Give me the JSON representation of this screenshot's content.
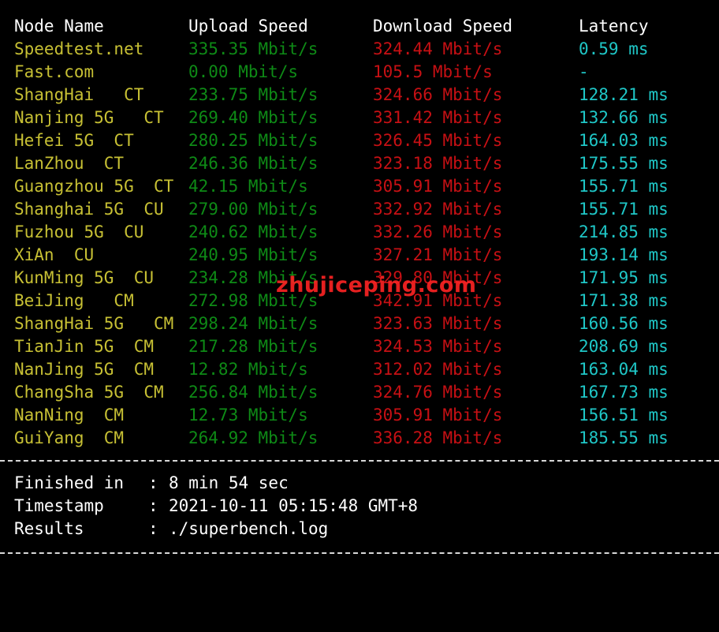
{
  "headers": {
    "node": "Node Name",
    "upload": "Upload Speed",
    "download": "Download Speed",
    "latency": "Latency"
  },
  "rows": [
    {
      "node": "Speedtest.net",
      "upload": "335.35 Mbit/s",
      "download": "324.44 Mbit/s",
      "latency": "0.59 ms"
    },
    {
      "node": "Fast.com",
      "upload": "0.00 Mbit/s",
      "download": "105.5 Mbit/s",
      "latency": "-"
    },
    {
      "node": "ShangHai   CT",
      "upload": "233.75 Mbit/s",
      "download": "324.66 Mbit/s",
      "latency": "128.21 ms"
    },
    {
      "node": "Nanjing 5G   CT",
      "upload": "269.40 Mbit/s",
      "download": "331.42 Mbit/s",
      "latency": "132.66 ms"
    },
    {
      "node": "Hefei 5G  CT",
      "upload": "280.25 Mbit/s",
      "download": "326.45 Mbit/s",
      "latency": "164.03 ms"
    },
    {
      "node": "LanZhou  CT",
      "upload": "246.36 Mbit/s",
      "download": "323.18 Mbit/s",
      "latency": "175.55 ms"
    },
    {
      "node": "Guangzhou 5G  CT",
      "upload": "42.15 Mbit/s",
      "download": "305.91 Mbit/s",
      "latency": "155.71 ms"
    },
    {
      "node": "Shanghai 5G  CU",
      "upload": "279.00 Mbit/s",
      "download": "332.92 Mbit/s",
      "latency": "155.71 ms"
    },
    {
      "node": "Fuzhou 5G  CU",
      "upload": "240.62 Mbit/s",
      "download": "332.26 Mbit/s",
      "latency": "214.85 ms"
    },
    {
      "node": "XiAn  CU",
      "upload": "240.95 Mbit/s",
      "download": "327.21 Mbit/s",
      "latency": "193.14 ms"
    },
    {
      "node": "KunMing 5G  CU",
      "upload": "234.28 Mbit/s",
      "download": "329.80 Mbit/s",
      "latency": "171.95 ms"
    },
    {
      "node": "BeiJing   CM",
      "upload": "272.98 Mbit/s",
      "download": "342.91 Mbit/s",
      "latency": "171.38 ms"
    },
    {
      "node": "ShangHai 5G   CM",
      "upload": "298.24 Mbit/s",
      "download": "323.63 Mbit/s",
      "latency": "160.56 ms"
    },
    {
      "node": "TianJin 5G  CM",
      "upload": "217.28 Mbit/s",
      "download": "324.53 Mbit/s",
      "latency": "208.69 ms"
    },
    {
      "node": "NanJing 5G  CM",
      "upload": "12.82 Mbit/s",
      "download": "312.02 Mbit/s",
      "latency": "163.04 ms"
    },
    {
      "node": "ChangSha 5G  CM",
      "upload": "256.84 Mbit/s",
      "download": "324.76 Mbit/s",
      "latency": "167.73 ms"
    },
    {
      "node": "NanNing  CM",
      "upload": "12.73 Mbit/s",
      "download": "305.91 Mbit/s",
      "latency": "156.51 ms"
    },
    {
      "node": "GuiYang  CM",
      "upload": "264.92 Mbit/s",
      "download": "336.28 Mbit/s",
      "latency": "185.55 ms"
    }
  ],
  "summary": {
    "finished_label": "Finished in",
    "finished_value": "8 min 54 sec",
    "timestamp_label": "Timestamp",
    "timestamp_value": "2021-10-11 05:15:48 GMT+8",
    "results_label": "Results",
    "results_value": "./superbench.log",
    "colon": ":"
  },
  "watermark": "zhujiceping.com",
  "colors": {
    "background": "#000000",
    "node": "#c7c034",
    "upload": "#0e8a16",
    "download": "#c71014",
    "latency": "#1fc7c7",
    "header": "#ffffff",
    "separator": "#d8d8d8"
  }
}
